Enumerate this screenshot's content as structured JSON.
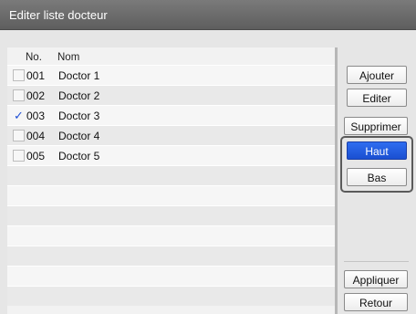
{
  "window": {
    "title": "Editer liste docteur"
  },
  "list": {
    "headers": {
      "no": "No.",
      "nom": "Nom"
    },
    "rows": [
      {
        "no": "001",
        "name": "Doctor 1",
        "checked": false,
        "check_glyph": ""
      },
      {
        "no": "002",
        "name": "Doctor 2",
        "checked": false,
        "check_glyph": ""
      },
      {
        "no": "003",
        "name": "Doctor 3",
        "checked": true,
        "check_glyph": "✓"
      },
      {
        "no": "004",
        "name": "Doctor 4",
        "checked": false,
        "check_glyph": ""
      },
      {
        "no": "005",
        "name": "Doctor 5",
        "checked": false,
        "check_glyph": ""
      },
      {
        "no": "",
        "name": "",
        "checked": false,
        "check_glyph": ""
      },
      {
        "no": "",
        "name": "",
        "checked": false,
        "check_glyph": ""
      },
      {
        "no": "",
        "name": "",
        "checked": false,
        "check_glyph": ""
      },
      {
        "no": "",
        "name": "",
        "checked": false,
        "check_glyph": ""
      },
      {
        "no": "",
        "name": "",
        "checked": false,
        "check_glyph": ""
      },
      {
        "no": "",
        "name": "",
        "checked": false,
        "check_glyph": ""
      },
      {
        "no": "",
        "name": "",
        "checked": false,
        "check_glyph": ""
      }
    ]
  },
  "buttons": {
    "ajouter": "Ajouter",
    "editer": "Editer",
    "supprimer": "Supprimer",
    "haut": "Haut",
    "bas": "Bas",
    "appliquer": "Appliquer",
    "retour": "Retour"
  },
  "colors": {
    "accent": "#1a4fd1",
    "titlebar": "#6b6b6b",
    "check": "#1e4fd6"
  }
}
